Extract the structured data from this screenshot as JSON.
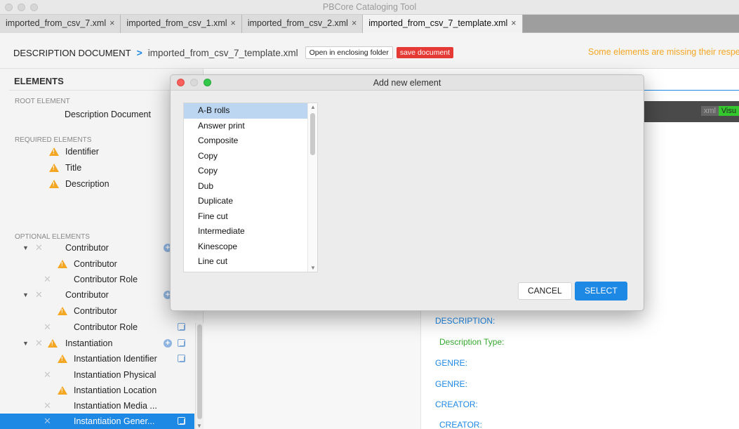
{
  "window": {
    "title": "PBCore Cataloging Tool"
  },
  "tabs": [
    {
      "label": "imported_from_csv_7.xml",
      "close": "×"
    },
    {
      "label": "imported_from_csv_1.xml",
      "close": "×"
    },
    {
      "label": "imported_from_csv_2.xml",
      "close": "×"
    },
    {
      "label": "imported_from_csv_7_template.xml",
      "close": "×",
      "active": true
    }
  ],
  "breadcrumb": {
    "root": "DESCRIPTION DOCUMENT",
    "separator": ">",
    "file": "imported_from_csv_7_template.xml",
    "open_folder_label": "Open in enclosing folder",
    "save_label": "save document",
    "warning": "Some elements are missing their respe"
  },
  "sidebar": {
    "heading": "ELEMENTS",
    "root_label": "ROOT ELEMENT",
    "root_element": "Description Document",
    "required_label": "REQUIRED ELEMENTS",
    "required": [
      "Identifier",
      "Title",
      "Description"
    ],
    "optional_label": "OPTIONAL ELEMENTS",
    "optional": [
      "Contributor",
      "Contributor",
      "Contributor Role",
      "Contributor",
      "Contributor",
      "Contributor Role",
      "Instantiation",
      "Instantiation Identifier",
      "Instantiation Physical",
      "Instantiation Location",
      "Instantiation Media ...",
      "Instantiation Gener..."
    ],
    "icons": {
      "warning": "warning-triangle-icon",
      "remove": "x-icon",
      "add": "plus-circle-icon",
      "duplicate": "copy-icon",
      "expand": "triangle-down-icon"
    }
  },
  "view_toggle": {
    "xml": "xml",
    "visual": "Visu"
  },
  "document": {
    "labels": [
      "DESCRIPTION:",
      "GENRE:",
      "GENRE:",
      "CREATOR:",
      "CREATOR:"
    ],
    "sub": "Description Type:"
  },
  "modal": {
    "title": "Add new element",
    "items": [
      "A-B rolls",
      "Answer print",
      "Composite",
      "Copy",
      "Copy",
      "Dub",
      "Duplicate",
      "Fine cut",
      "Intermediate",
      "Kinescope",
      "Line cut"
    ],
    "selected_index": 0,
    "cancel_label": "CANCEL",
    "select_label": "SELECT"
  },
  "colors": {
    "accent": "#1e88e5",
    "warning": "#f5a623",
    "save": "#e53935",
    "visual_toggle": "#35c82e",
    "doc_sub": "#35a82e"
  }
}
